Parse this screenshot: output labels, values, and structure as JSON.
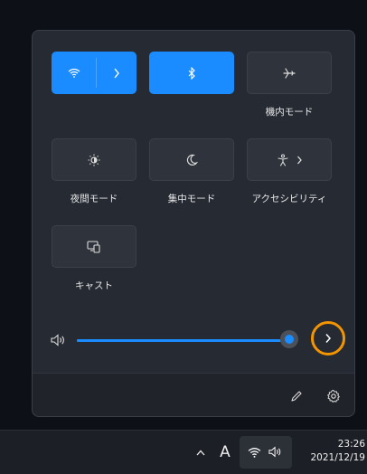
{
  "quick_settings": {
    "tiles": [
      {
        "id": "wifi",
        "label": "",
        "active": true,
        "icon": "wifi-icon"
      },
      {
        "id": "bluetooth",
        "label": "",
        "active": true,
        "icon": "bluetooth-icon"
      },
      {
        "id": "airplane",
        "label": "機内モード",
        "active": false,
        "icon": "airplane-icon"
      },
      {
        "id": "night",
        "label": "夜間モード",
        "active": false,
        "icon": "brightness-icon"
      },
      {
        "id": "focus",
        "label": "集中モード",
        "active": false,
        "icon": "moon-icon"
      },
      {
        "id": "accessibility",
        "label": "アクセシビリティ",
        "active": false,
        "icon": "accessibility-icon"
      },
      {
        "id": "cast",
        "label": "キャスト",
        "active": false,
        "icon": "cast-icon"
      }
    ],
    "volume": {
      "level_fraction": 0.98,
      "icon": "speaker-icon"
    },
    "accent_color": "#1a8cff",
    "highlight_color": "#f29500"
  },
  "taskbar": {
    "ime_indicator": "A",
    "time": "23:26",
    "date": "2021/12/19"
  }
}
